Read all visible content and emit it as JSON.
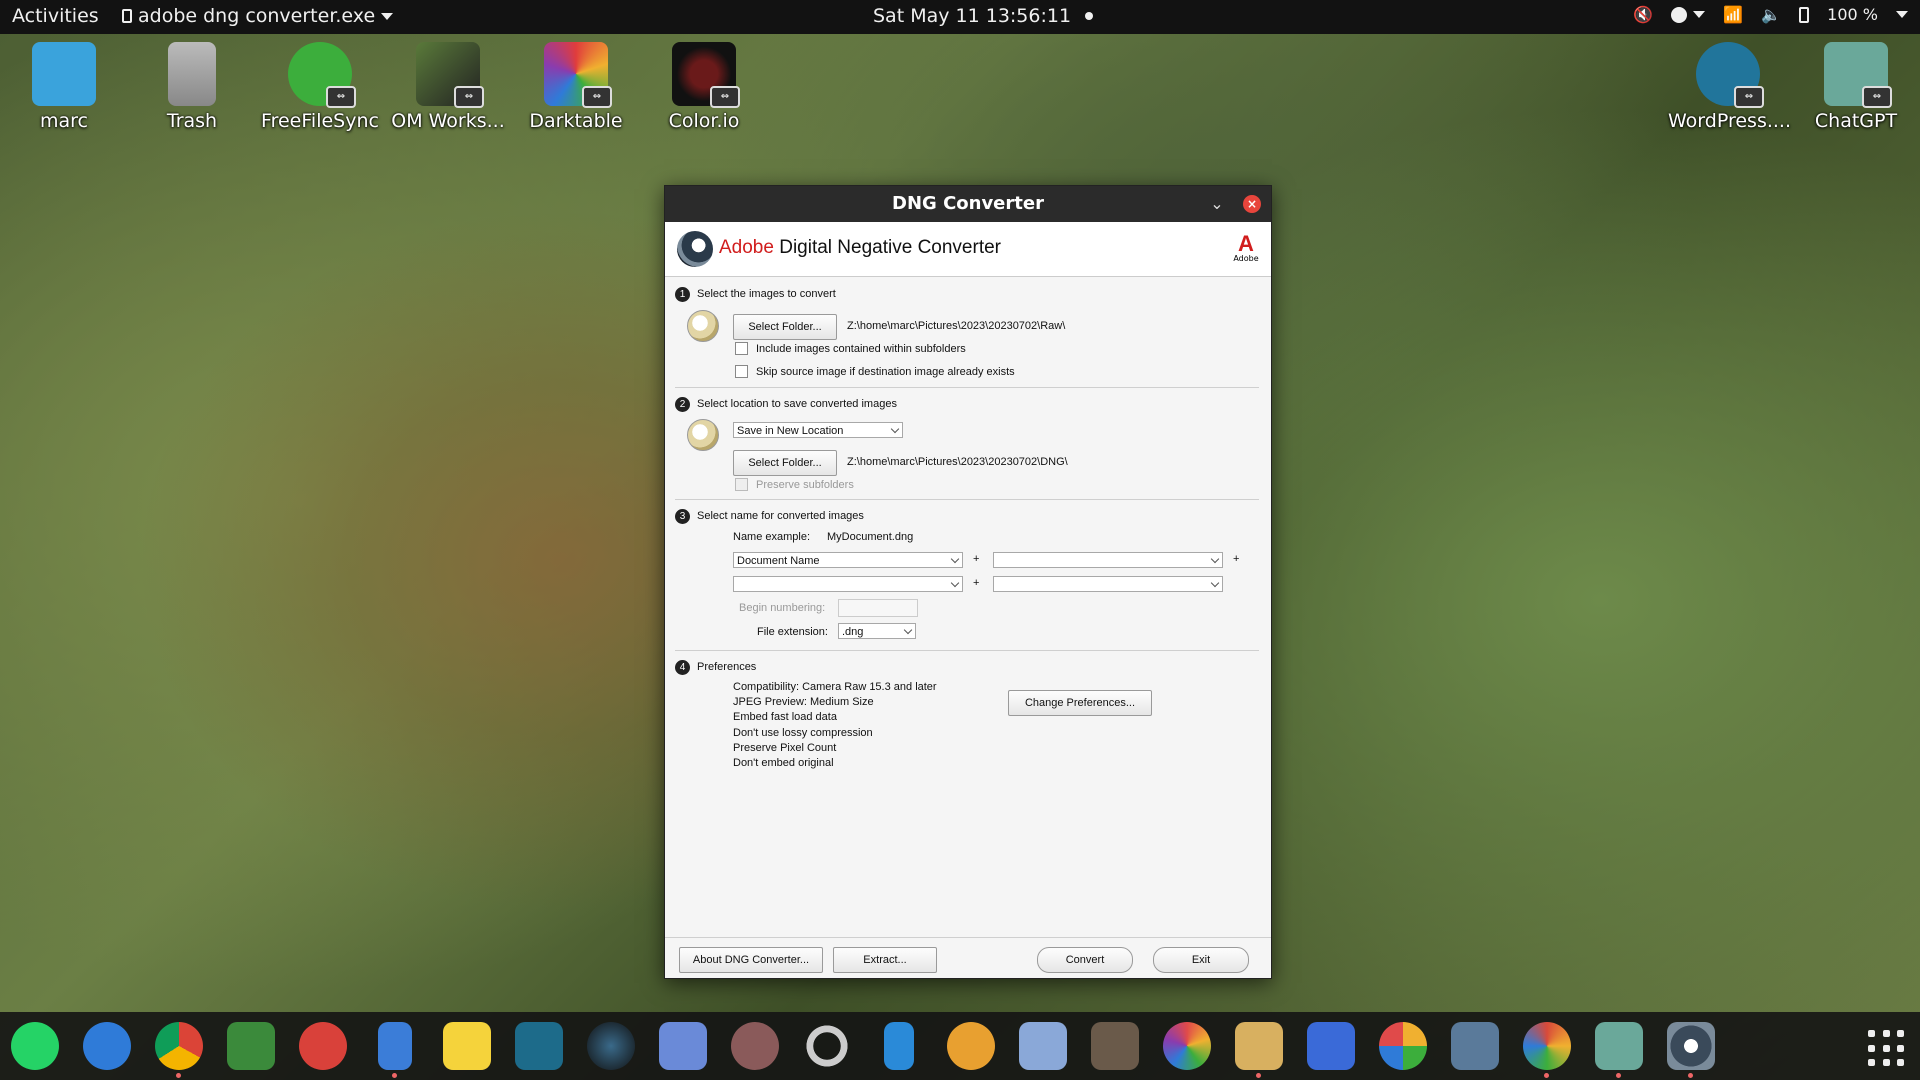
{
  "topbar": {
    "activities": "Activities",
    "app_name": "adobe dng converter.exe",
    "datetime": "Sat May 11  13:56:11",
    "battery": "100 %"
  },
  "desktop_icons": [
    {
      "label": "marc",
      "icon": "home-folder-icon",
      "color": "#3aa3dc"
    },
    {
      "label": "Trash",
      "icon": "trash-icon",
      "color": "#9a9a9a"
    },
    {
      "label": "FreeFileSync",
      "icon": "freefilesync-icon",
      "color": "#3cae3c"
    },
    {
      "label": "OM Works...",
      "icon": "om-workspace-icon",
      "color": "#556b2f"
    },
    {
      "label": "Darktable",
      "icon": "darktable-icon",
      "color": "#e03c3c"
    },
    {
      "label": "Color.io",
      "icon": "colorio-icon",
      "color": "#1a1a1a"
    },
    {
      "label": "WordPress....",
      "icon": "wordpress-icon",
      "color": "#21759b"
    },
    {
      "label": "ChatGPT",
      "icon": "chatgpt-icon",
      "color": "#6aa89a"
    }
  ],
  "window": {
    "title": "DNG Converter",
    "brand_adobe": "Adobe",
    "brand_product": "Digital Negative Converter",
    "adobe_logo_text": "Adobe",
    "sections": {
      "s1": {
        "num": "1",
        "title": "Select the images to convert",
        "select_folder": "Select Folder...",
        "path": "Z:\\home\\marc\\Pictures\\2023\\20230702\\Raw\\",
        "include_subfolders": "Include images contained within subfolders",
        "skip_existing": "Skip source image if destination image already exists"
      },
      "s2": {
        "num": "2",
        "title": "Select location to save converted images",
        "location": "Save in New Location",
        "select_folder": "Select Folder...",
        "path": "Z:\\home\\marc\\Pictures\\2023\\20230702\\DNG\\",
        "preserve_subfolders": "Preserve subfolders"
      },
      "s3": {
        "num": "3",
        "title": "Select name for converted images",
        "name_example_label": "Name example:",
        "name_example_value": "MyDocument.dng",
        "name_part1": "Document Name",
        "plus": "+",
        "begin_numbering": "Begin numbering:",
        "file_extension_label": "File extension:",
        "file_extension_value": ".dng"
      },
      "s4": {
        "num": "4",
        "title": "Preferences",
        "lines": [
          "Compatibility: Camera Raw 15.3 and later",
          "JPEG Preview: Medium Size",
          "Embed fast load data",
          "Don't use lossy compression",
          "Preserve Pixel Count",
          "Don't embed original"
        ],
        "change_prefs": "Change Preferences..."
      }
    },
    "footer": {
      "about": "About DNG Converter...",
      "extract": "Extract...",
      "convert": "Convert",
      "exit": "Exit"
    }
  },
  "dock": [
    {
      "icon": "whatsapp-icon",
      "color": "#25d366"
    },
    {
      "icon": "thunderbird-icon",
      "color": "#2f7bd8"
    },
    {
      "icon": "chrome-icon",
      "color": "#db4437"
    },
    {
      "icon": "recycle-app-icon",
      "color": "#3b8a3b"
    },
    {
      "icon": "red-app-icon",
      "color": "#d9413a"
    },
    {
      "icon": "files-icon",
      "color": "#3b7dd8"
    },
    {
      "icon": "notes-icon",
      "color": "#f5d33b"
    },
    {
      "icon": "panel-app-icon",
      "color": "#1d6b8a"
    },
    {
      "icon": "lens-app-icon",
      "color": "#2a4a6a"
    },
    {
      "icon": "image-viewer-icon",
      "color": "#6a8ad8"
    },
    {
      "icon": "camera-app-icon",
      "color": "#8a5a5a"
    },
    {
      "icon": "ring-app-icon",
      "color": "#cccccc"
    },
    {
      "icon": "pen-app-icon",
      "color": "#2a8ad8"
    },
    {
      "icon": "disc-app-icon",
      "color": "#e8a030"
    },
    {
      "icon": "wine-app-icon",
      "color": "#8aa8d8"
    },
    {
      "icon": "gimp-icon",
      "color": "#6a5a4a"
    },
    {
      "icon": "color-wheel-icon",
      "color": "#e04a4a"
    },
    {
      "icon": "photos-icon",
      "color": "#d8b060"
    },
    {
      "icon": "books-app-icon",
      "color": "#3a6ad8"
    },
    {
      "icon": "pinwheel-icon",
      "color": "#f0b030"
    },
    {
      "icon": "screenshot-icon",
      "color": "#5a7a9a"
    },
    {
      "icon": "color-app-icon",
      "color": "#d84a3a"
    },
    {
      "icon": "chatgpt-dock-icon",
      "color": "#6aa89a"
    },
    {
      "icon": "dng-converter-dock-icon",
      "color": "#3a4a5a"
    }
  ]
}
